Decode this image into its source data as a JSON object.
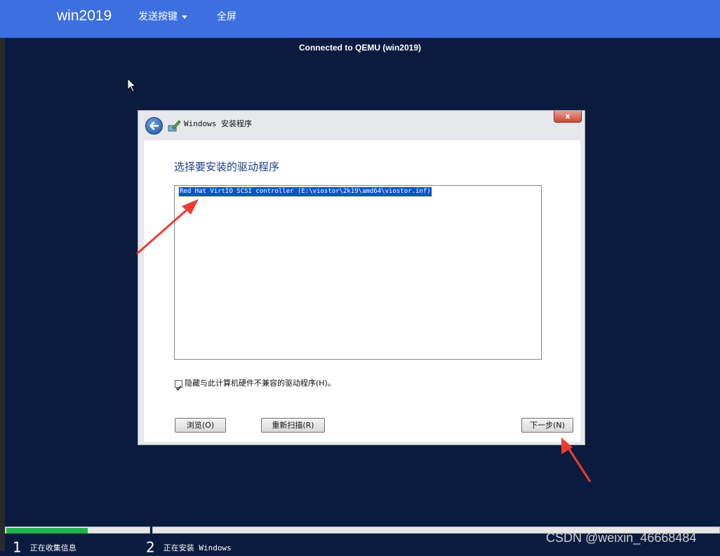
{
  "topbar": {
    "brand": "win2019",
    "send_keys_label": "发送按键",
    "fullscreen_label": "全屏"
  },
  "vnc": {
    "status": "Connected to QEMU (win2019)"
  },
  "dialog": {
    "title": "Windows 安装程序",
    "close_label": "x",
    "heading": "选择要安装的驱动程序",
    "drivers": [
      "Red Hat VirtIO SCSI controller (E:\\viostor\\2k19\\amd64\\viostor.inf)"
    ],
    "hide_incompatible_label": "隐藏与此计算机硬件不兼容的驱动程序(H)。",
    "hide_incompatible_checked": true,
    "browse_label": "浏览(O)",
    "rescan_label": "重新扫描(R)",
    "next_label": "下一步(N)"
  },
  "setup_progress": {
    "progress_fraction": 0.57,
    "steps": [
      {
        "number": "1",
        "label": "正在收集信息"
      },
      {
        "number": "2",
        "label": "正在安装 Windows"
      }
    ]
  },
  "watermark": "CSDN @weixin_46668484",
  "colors": {
    "topbar": "#3d6fe0",
    "background": "#0b1b40",
    "selection": "#0b57c4",
    "progress": "#22b04b",
    "annotation_arrow": "#ee3b2f"
  }
}
